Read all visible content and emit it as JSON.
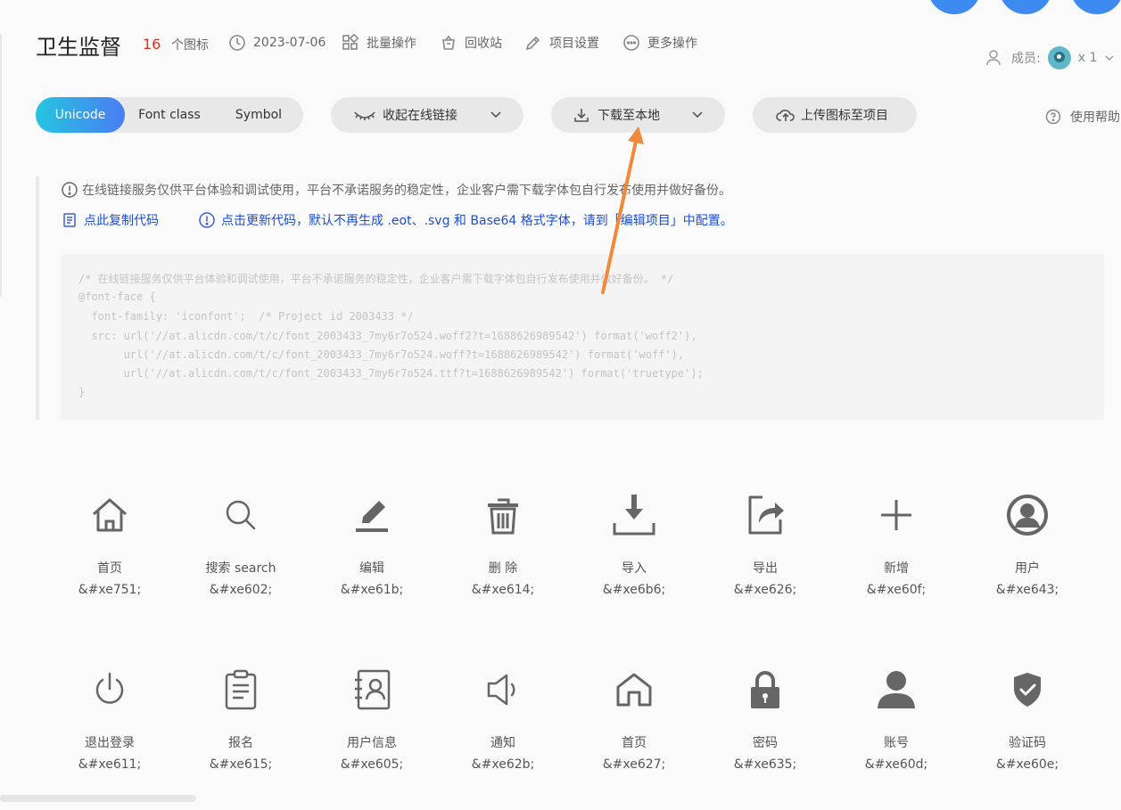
{
  "header": {
    "title": "卫生监督",
    "icon_count": "16",
    "icon_count_unit": "个图标",
    "date": "2023-07-06",
    "batch": "批量操作",
    "recycle": "回收站",
    "settings": "项目设置",
    "more": "更多操作",
    "members_label": "成员:",
    "members_count": "x 1"
  },
  "toolbar": {
    "tabs": [
      "Unicode",
      "Font class",
      "Symbol"
    ],
    "active_tab": "Unicode",
    "collapse_label": "收起在线链接",
    "download_label": "下载至本地",
    "upload_label": "上传图标至项目",
    "help_label": "使用帮助"
  },
  "notice": {
    "text": "在线链接服务仅供平台体验和调试使用，平台不承诺服务的稳定性，企业客户需下载字体包自行发布使用并做好备份。",
    "copy_code": "点此复制代码",
    "update_code": "点击更新代码，默认不再生成 .eot、.svg 和 Base64 格式字体，请到「编辑项目」中配置。"
  },
  "code_lines": [
    "/* 在线链接服务仅供平台体验和调试使用，平台不承诺服务的稳定性，企业客户需下载字体包自行发布使用并做好备份。 */",
    "@font-face {",
    "  font-family: 'iconfont';  /* Project id 2003433 */",
    "  src: url('//at.alicdn.com/t/c/font_2003433_7my6r7o524.woff2?t=1688626989542') format('woff2'),",
    "       url('//at.alicdn.com/t/c/font_2003433_7my6r7o524.woff?t=1688626989542') format('woff'),",
    "       url('//at.alicdn.com/t/c/font_2003433_7my6r7o524.ttf?t=1688626989542') format('truetype');",
    "}"
  ],
  "icons": [
    {
      "icon": "home-icon",
      "name": "首页",
      "code": "&#xe751;"
    },
    {
      "icon": "search-icon",
      "name": "搜索 search",
      "code": "&#xe602;"
    },
    {
      "icon": "edit-icon",
      "name": "编辑",
      "code": "&#xe61b;"
    },
    {
      "icon": "trash-icon",
      "name": "删 除",
      "code": "&#xe614;"
    },
    {
      "icon": "import-icon",
      "name": "导入",
      "code": "&#xe6b6;"
    },
    {
      "icon": "export-icon",
      "name": "导出",
      "code": "&#xe626;"
    },
    {
      "icon": "plus-icon",
      "name": "新增",
      "code": "&#xe60f;"
    },
    {
      "icon": "user-circle-icon",
      "name": "用户",
      "code": "&#xe643;"
    },
    {
      "icon": "power-icon",
      "name": "退出登录",
      "code": "&#xe611;"
    },
    {
      "icon": "clipboard-icon",
      "name": "报名",
      "code": "&#xe615;"
    },
    {
      "icon": "contact-card-icon",
      "name": "用户信息",
      "code": "&#xe605;"
    },
    {
      "icon": "speaker-icon",
      "name": "通知",
      "code": "&#xe62b;"
    },
    {
      "icon": "house-icon",
      "name": "首页",
      "code": "&#xe627;"
    },
    {
      "icon": "lock-icon",
      "name": "密码",
      "code": "&#xe635;"
    },
    {
      "icon": "person-icon",
      "name": "账号",
      "code": "&#xe60d;"
    },
    {
      "icon": "shield-check-icon",
      "name": "验证码",
      "code": "&#xe60e;"
    }
  ],
  "colors": {
    "accent_gradient_start": "#25c5e0",
    "accent_gradient_end": "#4a7df3",
    "link": "#1f4fcf",
    "count_red": "#e0311b",
    "arrow_orange": "#f08a3a",
    "circle_blue": "#3d8bf0"
  }
}
